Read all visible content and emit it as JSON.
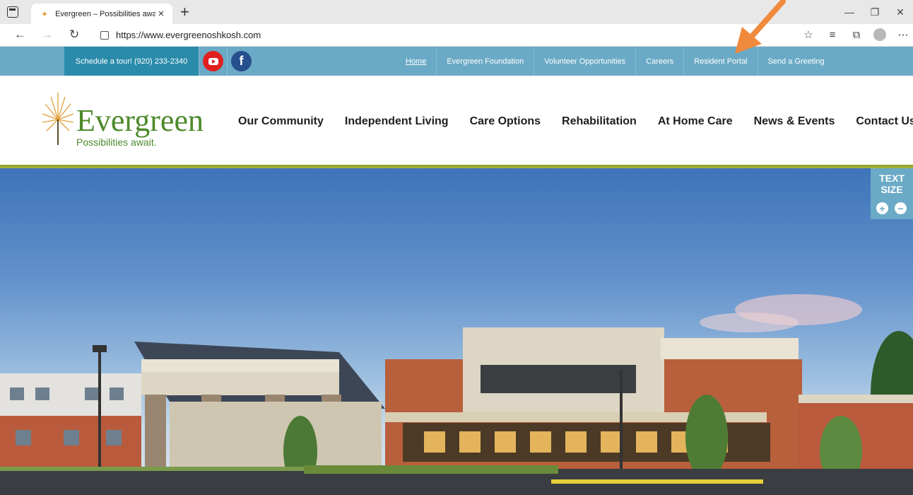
{
  "browser": {
    "tab_title": "Evergreen – Possibilities await.",
    "url": "https://www.evergreenoshkosh.com"
  },
  "topbar": {
    "schedule": "Schedule a tour! (920) 233-2340",
    "links": [
      "Home",
      "Evergreen Foundation",
      "Volunteer Opportunities",
      "Careers",
      "Resident Portal",
      "Send a Greeting"
    ]
  },
  "header": {
    "brand": "Evergreen",
    "tagline": "Possibilities await.",
    "nav": [
      "Our Community",
      "Independent Living",
      "Care Options",
      "Rehabilitation",
      "At Home Care",
      "News & Events",
      "Contact Us"
    ]
  },
  "textsize": {
    "label": "TEXT\nSIZE",
    "plus": "+",
    "minus": "−"
  },
  "colors": {
    "topbar": "#6aaac6",
    "schedule_bg": "#2b8bab",
    "brand_green": "#4d8a2a",
    "annotation_arrow": "#f08a3c"
  },
  "icons": [
    "youtube-icon",
    "facebook-icon",
    "lock-icon",
    "back-icon",
    "forward-icon",
    "refresh-icon",
    "favorites-icon",
    "collections-icon",
    "more-icon"
  ]
}
